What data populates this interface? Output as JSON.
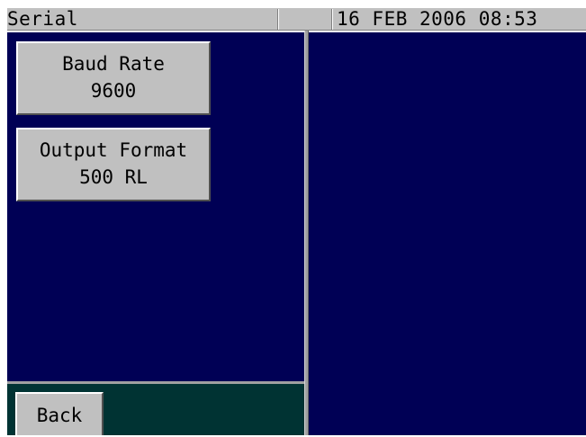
{
  "title_bar": {
    "title": "Serial",
    "datetime": "16 FEB 2006 08:53"
  },
  "buttons": {
    "baud_rate": {
      "label": "Baud Rate",
      "value": "9600"
    },
    "output_format": {
      "label": "Output Format",
      "value": "500 RL"
    },
    "back": {
      "label": "Back"
    }
  },
  "colors": {
    "panel": "#000055",
    "button_strip": "#003333",
    "button_face": "#c0c0c0",
    "title_bar": "#c0c0c0"
  }
}
